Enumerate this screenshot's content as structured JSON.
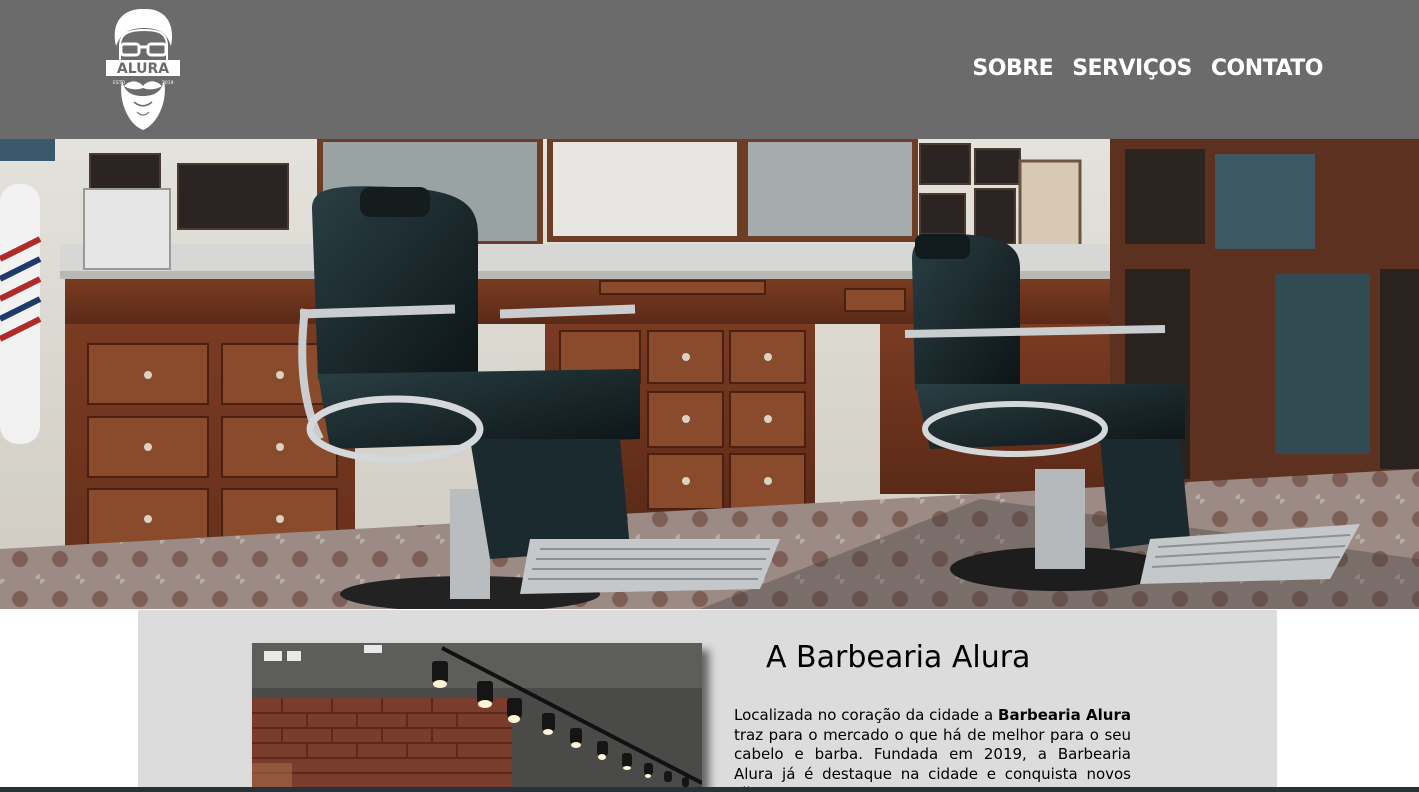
{
  "header": {
    "logo": {
      "brand": "ALURA",
      "est_left": "ESTD",
      "est_right": "2019"
    },
    "nav": [
      {
        "label": "SOBRE"
      },
      {
        "label": "SERVIÇOS"
      },
      {
        "label": "CONTATO"
      }
    ]
  },
  "hero": {
    "image": "barbershop-interior-photo"
  },
  "about": {
    "image": "barbershop-ceiling-lights-photo",
    "title": "A Barbearia Alura",
    "text_intro": "Localizada no coração da cidade a ",
    "text_brand": "Barbearia Alura",
    "text_rest": " traz para o mercado o que há de melhor para o seu cabelo e barba. Fundada em 2019, a Barbearia Alura já é destaque na cidade e conquista novos clientes a"
  },
  "colors": {
    "header_bg": "#6b6b6b",
    "nav_text": "#ffffff",
    "section_bg": "#dcdcdc",
    "bottom_strip": "#263238"
  }
}
